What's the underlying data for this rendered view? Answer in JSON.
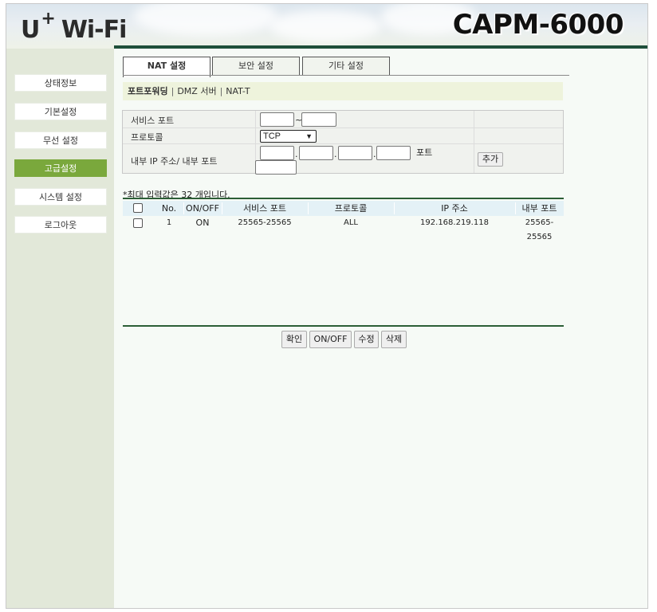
{
  "header": {
    "brand": {
      "u": "U",
      "plus": "+",
      "wifi": "Wi-Fi"
    },
    "model": "CAPM-6000"
  },
  "sidebar": {
    "items": [
      {
        "label": "상태정보",
        "active": false
      },
      {
        "label": "기본설정",
        "active": false
      },
      {
        "label": "무선 설정",
        "active": false
      },
      {
        "label": "고급설정",
        "active": true
      },
      {
        "label": "시스템 설정",
        "active": false
      },
      {
        "label": "로그아웃",
        "active": false
      }
    ]
  },
  "tabs": [
    {
      "label": "NAT 설정",
      "active": true
    },
    {
      "label": "보안 설정",
      "active": false
    },
    {
      "label": "기타 설정",
      "active": false
    }
  ],
  "subnav": {
    "items": [
      "포트포워딩",
      "DMZ 서버",
      "NAT-T"
    ],
    "separator": "|"
  },
  "form": {
    "service_port_label": "서비스 포트",
    "range_sep": "~",
    "protocol_label": "프로토콜",
    "protocol_value": "TCP",
    "internal_label": "내부 IP 주소/ 내부 포트",
    "ip_dot": ".",
    "port_label": "포트",
    "add_button": "추가"
  },
  "table": {
    "note": "*최대 입력값은 32 개입니다.",
    "columns": [
      "No.",
      "ON/OFF",
      "서비스 포트",
      "프로토콜",
      "IP 주소",
      "내부 포트"
    ],
    "rows": [
      {
        "no": "1",
        "onoff": "ON",
        "service_port": "25565-25565",
        "protocol": "ALL",
        "ip": "192.168.219.118",
        "internal_port": "25565-25565"
      }
    ]
  },
  "actions": {
    "confirm": "확인",
    "onoff": "ON/OFF",
    "edit": "수정",
    "delete": "삭제"
  },
  "colors": {
    "accent_green": "#7aa83c",
    "header_bar": "#1f4f3a",
    "table_line": "#2c5e36",
    "table_header_bg": "#e4f1f6",
    "subnav_bg": "#eef3dc"
  },
  "icons": {
    "select_arrow": "chevron-down-icon"
  }
}
